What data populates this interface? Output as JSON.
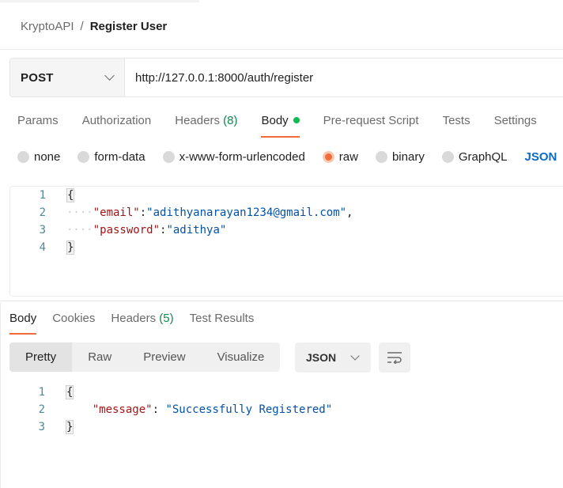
{
  "breadcrumb": {
    "parent": "KryptoAPI",
    "separator": "/",
    "current": "Register User"
  },
  "request": {
    "method": "POST",
    "url": "http://127.0.0.1:8000/auth/register"
  },
  "request_tabs": [
    {
      "label": "Params"
    },
    {
      "label": "Authorization"
    },
    {
      "label": "Headers",
      "count": "(8)"
    },
    {
      "label": "Body",
      "active": true
    },
    {
      "label": "Pre-request Script"
    },
    {
      "label": "Tests"
    },
    {
      "label": "Settings"
    }
  ],
  "body_types": {
    "none": "none",
    "form_data": "form-data",
    "urlencoded": "x-www-form-urlencoded",
    "raw": "raw",
    "binary": "binary",
    "graphql": "GraphQL",
    "format": "JSON"
  },
  "request_body": {
    "line_numbers": [
      "1",
      "2",
      "3",
      "4"
    ],
    "open": "{",
    "close": "}",
    "email_key": "\"email\"",
    "email_value": "\"adithyanarayan1234@gmail.com\"",
    "password_key": "\"password\"",
    "password_value": "\"adithya\""
  },
  "response_tabs": {
    "body": "Body",
    "cookies": "Cookies",
    "headers": "Headers",
    "headers_count": "(5)",
    "test_results": "Test Results"
  },
  "view_modes": {
    "pretty": "Pretty",
    "raw": "Raw",
    "preview": "Preview",
    "visualize": "Visualize"
  },
  "response_format": "JSON",
  "response_body": {
    "line_numbers": [
      "1",
      "2",
      "3"
    ],
    "open": "{",
    "close": "}",
    "message_key": "\"message\"",
    "message_value": "\"Successfully Registered\""
  },
  "colors": {
    "accent": "#f26b3a",
    "success": "#0cbb52",
    "link": "#0b6bcb",
    "json_key": "#a31515",
    "json_string": "#0451a5"
  }
}
